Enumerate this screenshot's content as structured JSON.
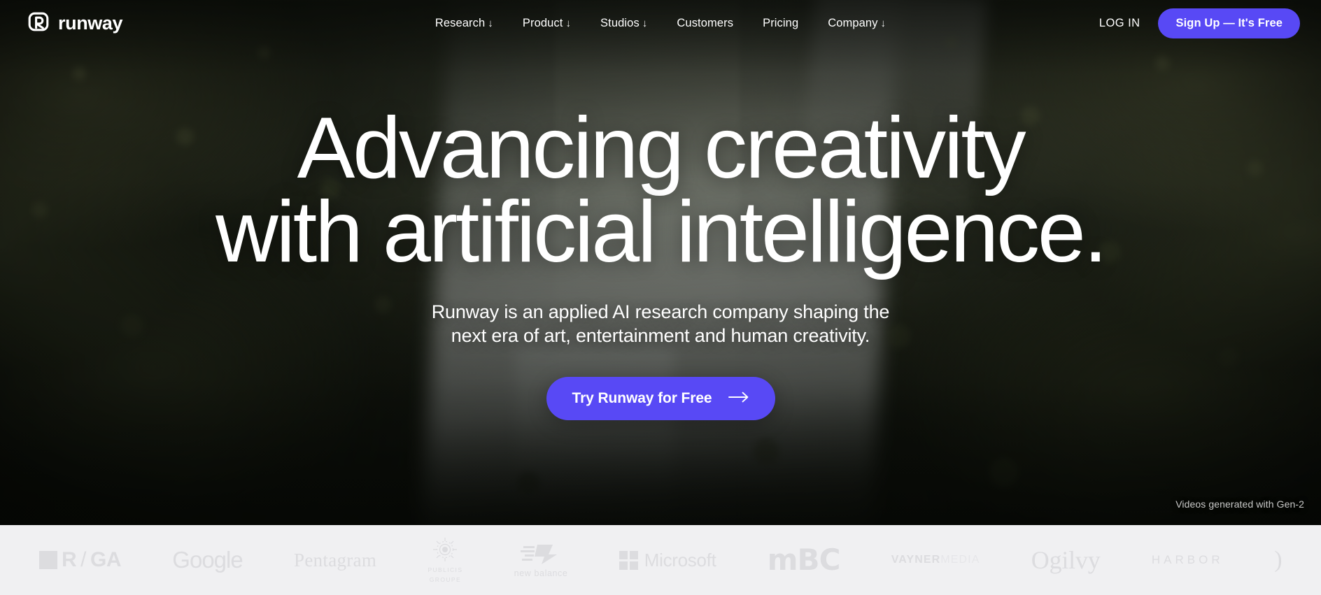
{
  "brand": {
    "name": "runway",
    "logo_icon": "runway-r-mark-icon"
  },
  "nav": {
    "items": [
      {
        "label": "Research",
        "caret": "↓",
        "has_dropdown": true
      },
      {
        "label": "Product",
        "caret": "↓",
        "has_dropdown": true
      },
      {
        "label": "Studios",
        "caret": "↓",
        "has_dropdown": true
      },
      {
        "label": "Customers",
        "caret": "",
        "has_dropdown": false
      },
      {
        "label": "Pricing",
        "caret": "",
        "has_dropdown": false
      },
      {
        "label": "Company",
        "caret": "↓",
        "has_dropdown": true
      }
    ],
    "login_label": "LOG IN",
    "signup_label": "Sign Up — It's Free"
  },
  "hero": {
    "headline_line1": "Advancing creativity",
    "headline_line2": "with artificial intelligence.",
    "subhead_line1": "Runway is an applied AI research company shaping the",
    "subhead_line2": "next era of art, entertainment and human creativity.",
    "cta_label": "Try Runway for Free",
    "cta_arrow_icon": "arrow-right-icon",
    "credit": "Videos generated with Gen-2",
    "background": "aerial forest with waterfall"
  },
  "logos": {
    "items": [
      {
        "name": "R/GA",
        "mark": "square",
        "text_a": "R",
        "text_b": "/",
        "text_c": "GA"
      },
      {
        "name": "Google",
        "text": "Google"
      },
      {
        "name": "Pentagram",
        "text": "Pentagram"
      },
      {
        "name": "Publicis Groupe",
        "text_a": "PUBLICIS",
        "text_b": "GROUPE"
      },
      {
        "name": "New Balance",
        "text": "new balance"
      },
      {
        "name": "Microsoft",
        "text": "Microsoft"
      },
      {
        "name": "MBC",
        "text": "mBC"
      },
      {
        "name": "VaynerMedia",
        "text_a": "VAYNER",
        "text_b": "MEDIA"
      },
      {
        "name": "Ogilvy",
        "text": "Ogilvy"
      },
      {
        "name": "Harbor",
        "text": "HARBOR"
      }
    ]
  },
  "colors": {
    "accent": "#5849f5",
    "logo_strip_bg": "#f0f0f2",
    "logo_gray": "#dcdcdf",
    "text_on_dark": "#ffffff"
  }
}
